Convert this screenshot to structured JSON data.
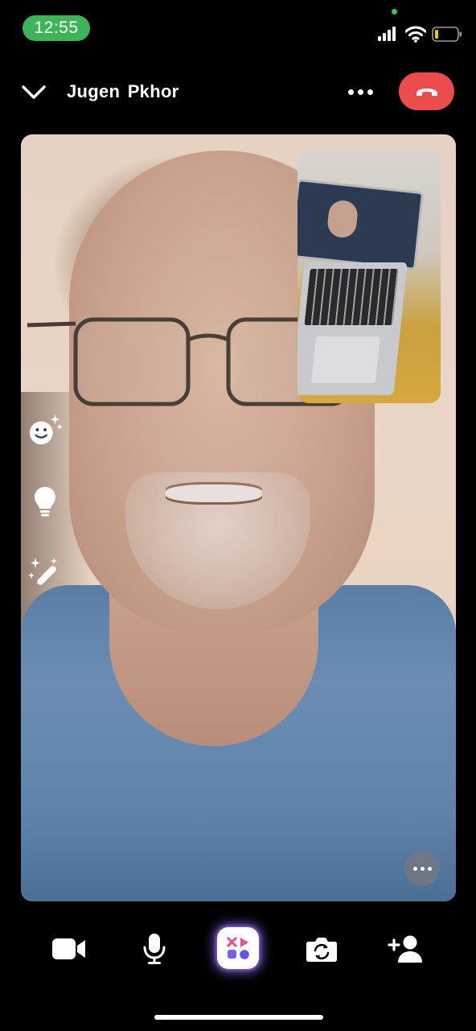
{
  "status_bar": {
    "time": "12:55",
    "icons": [
      "signal-bars-icon",
      "wifi-icon",
      "battery-low-icon"
    ],
    "time_pill_color": "#3eb35a"
  },
  "header": {
    "caller_name": "Jugen  Pkhor",
    "collapse_icon": "chevron-down-icon",
    "more_icon": "more-horizontal-icon",
    "end_call_icon": "phone-hangup-icon",
    "end_call_color": "#eb4d4d"
  },
  "video": {
    "side_tools": [
      "face-sparkle-icon",
      "lightbulb-icon",
      "magic-wand-icon"
    ],
    "more_icon": "more-horizontal-icon"
  },
  "controls": {
    "items": [
      "video-camera-icon",
      "microphone-icon",
      "effects-icon",
      "flip-camera-icon",
      "add-person-icon"
    ]
  }
}
